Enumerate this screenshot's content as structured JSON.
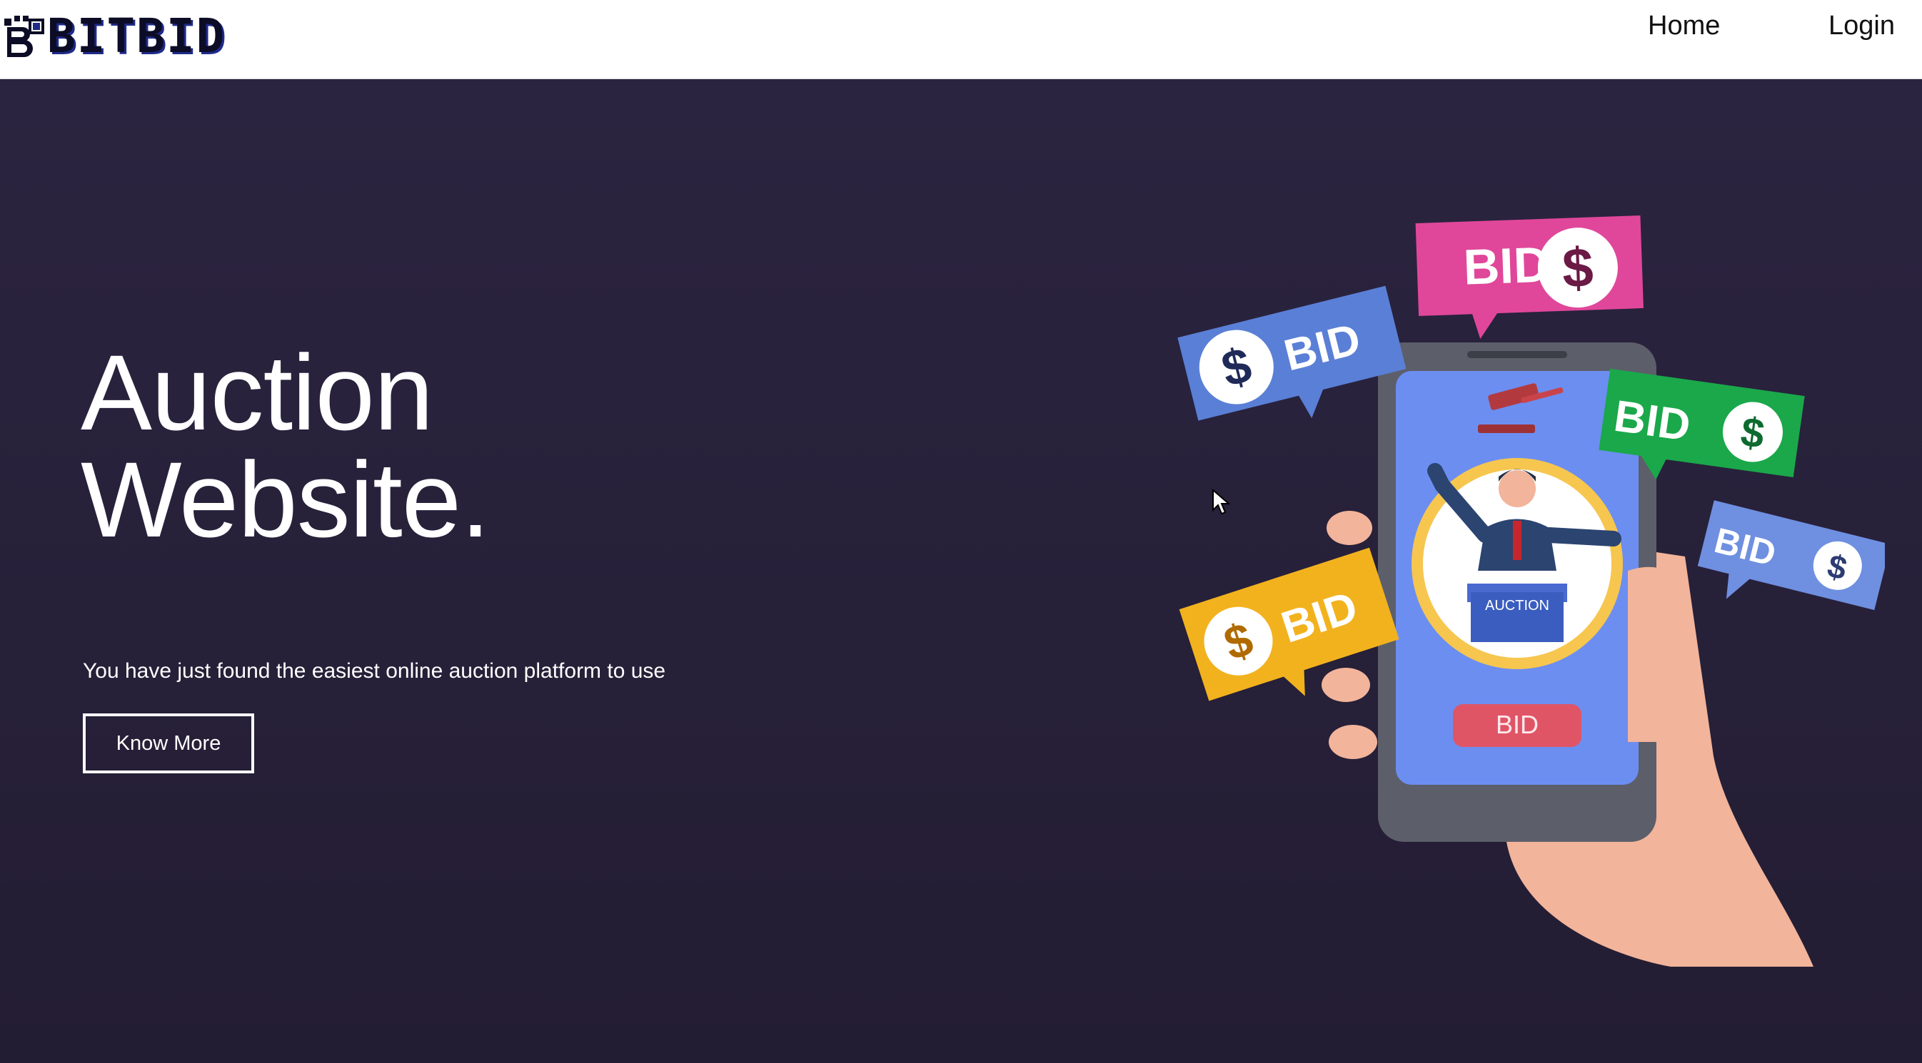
{
  "brand": {
    "name": "BITBID",
    "icon": "bitbid-logo-icon"
  },
  "nav": {
    "home_label": "Home",
    "login_label": "Login"
  },
  "hero": {
    "title_line1": "Auction",
    "title_line2": "Website.",
    "subtitle": "You have just found the easiest online auction platform to use",
    "cta_label": "Know More"
  },
  "illustration": {
    "bubble_label": "BID",
    "dollar_symbol": "$",
    "podium_label": "AUCTION",
    "phone_button_label": "BID"
  },
  "colors": {
    "hero_bg": "#27213a",
    "navbar_bg": "#ffffff",
    "bubble_pink": "#e0479a",
    "bubble_blue": "#5a7fd6",
    "bubble_green": "#1aa84a",
    "bubble_yellow": "#f2b21e",
    "phone_screen": "#6a8be8",
    "skin": "#f4b79c"
  }
}
